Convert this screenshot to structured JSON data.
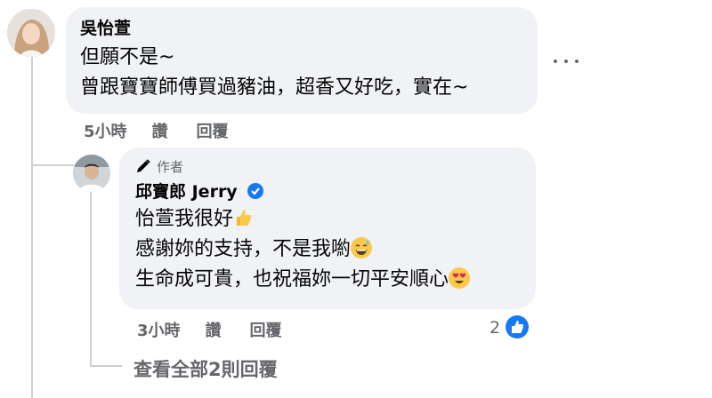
{
  "comment": {
    "author": "吳怡萱",
    "lines": [
      "但願不是~",
      "曾跟寶寶師傅買過豬油，超香又好吃，實在~"
    ],
    "time": "5小時",
    "like_label": "讚",
    "reply_label": "回覆"
  },
  "reply": {
    "badge": "作者",
    "author": "邱寶郎 Jerry",
    "lines": [
      "怡萱我很好",
      "感謝妳的支持，不是我喲",
      "生命成可貴，也祝福妳一切平安順心"
    ],
    "time": "3小時",
    "like_label": "讚",
    "reply_label": "回覆",
    "reaction_count": "2"
  },
  "view_all_replies": "查看全部2則回覆",
  "colors": {
    "bubble_bg": "#f0f2f5",
    "secondary_text": "#65676b",
    "accent_blue": "#1877f2",
    "thread_line": "#ccd0d5"
  },
  "icons": {
    "more": "more-horizontal-icon",
    "author_badge": "pencil-icon",
    "verified": "verified-badge-icon",
    "thumbs_up_emoji": "thumbs-up-emoji-icon",
    "grin_sweat_emoji": "grinning-sweat-emoji-icon",
    "heart_eyes_emoji": "heart-eyes-emoji-icon",
    "like_reaction": "like-reaction-icon"
  }
}
